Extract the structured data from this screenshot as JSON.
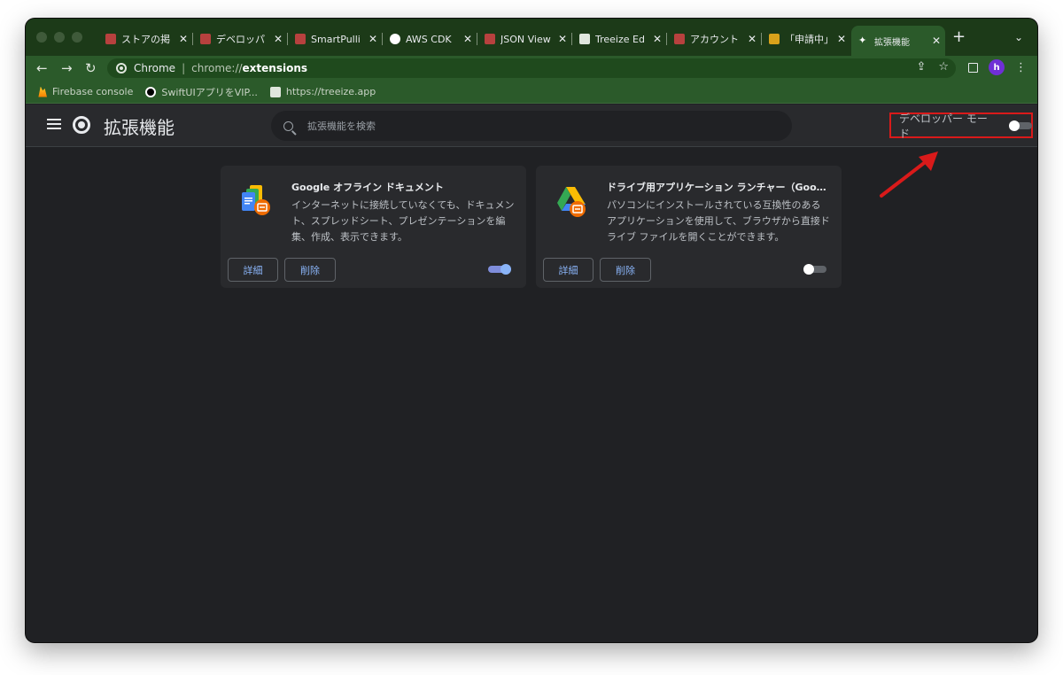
{
  "tabs": [
    {
      "title": "ストアの掲",
      "favicon": "store-icon",
      "color": "#b7413e"
    },
    {
      "title": "デベロッパ",
      "favicon": "store-icon",
      "color": "#b7413e"
    },
    {
      "title": "SmartPulli",
      "favicon": "store-icon",
      "color": "#b7413e"
    },
    {
      "title": "AWS CDK",
      "favicon": "github-icon",
      "color": "#ffffff"
    },
    {
      "title": "JSON View",
      "favicon": "store-icon",
      "color": "#b7413e"
    },
    {
      "title": "Treeize Ed",
      "favicon": "treeize-icon",
      "color": "#dfe6dd"
    },
    {
      "title": "アカウント",
      "favicon": "store-icon",
      "color": "#b7413e"
    },
    {
      "title": "「申請中」",
      "favicon": "w-icon",
      "color": "#d9a21b"
    },
    {
      "title": "拡張機能",
      "favicon": "puzzle-icon",
      "color": "#ffffff",
      "active": true
    }
  ],
  "omnibox": {
    "site": "Chrome",
    "scheme": "chrome://",
    "host": "extensions"
  },
  "profile": {
    "initial": "h"
  },
  "bookmarks": [
    {
      "label": "Firebase console",
      "icon": "firebase-icon"
    },
    {
      "label": "SwiftUIアプリをVIP...",
      "icon": "github-icon"
    },
    {
      "label": "https://treeize.app",
      "icon": "treeize-icon"
    }
  ],
  "header": {
    "title": "拡張機能",
    "search_placeholder": "拡張機能を検索",
    "devmode_label": "デベロッパー モード",
    "devmode_on": false
  },
  "extensions": [
    {
      "name": "Google オフライン ドキュメント",
      "description": "インターネットに接続していなくても、ドキュメント、スプレッドシート、プレゼンテーションを編集、作成、表示できます。",
      "details_label": "詳細",
      "remove_label": "削除",
      "enabled": true
    },
    {
      "name": "ドライブ用アプリケーション ランチャー（Google）",
      "description": "パソコンにインストールされている互換性のあるアプリケーションを使用して、ブラウザから直接ドライブ ファイルを開くことができます。",
      "details_label": "詳細",
      "remove_label": "削除",
      "enabled": false
    }
  ],
  "colors": {
    "annotation": "#d91a1a",
    "accent": "#8ab4f8",
    "frame": "#2b5a2a"
  }
}
